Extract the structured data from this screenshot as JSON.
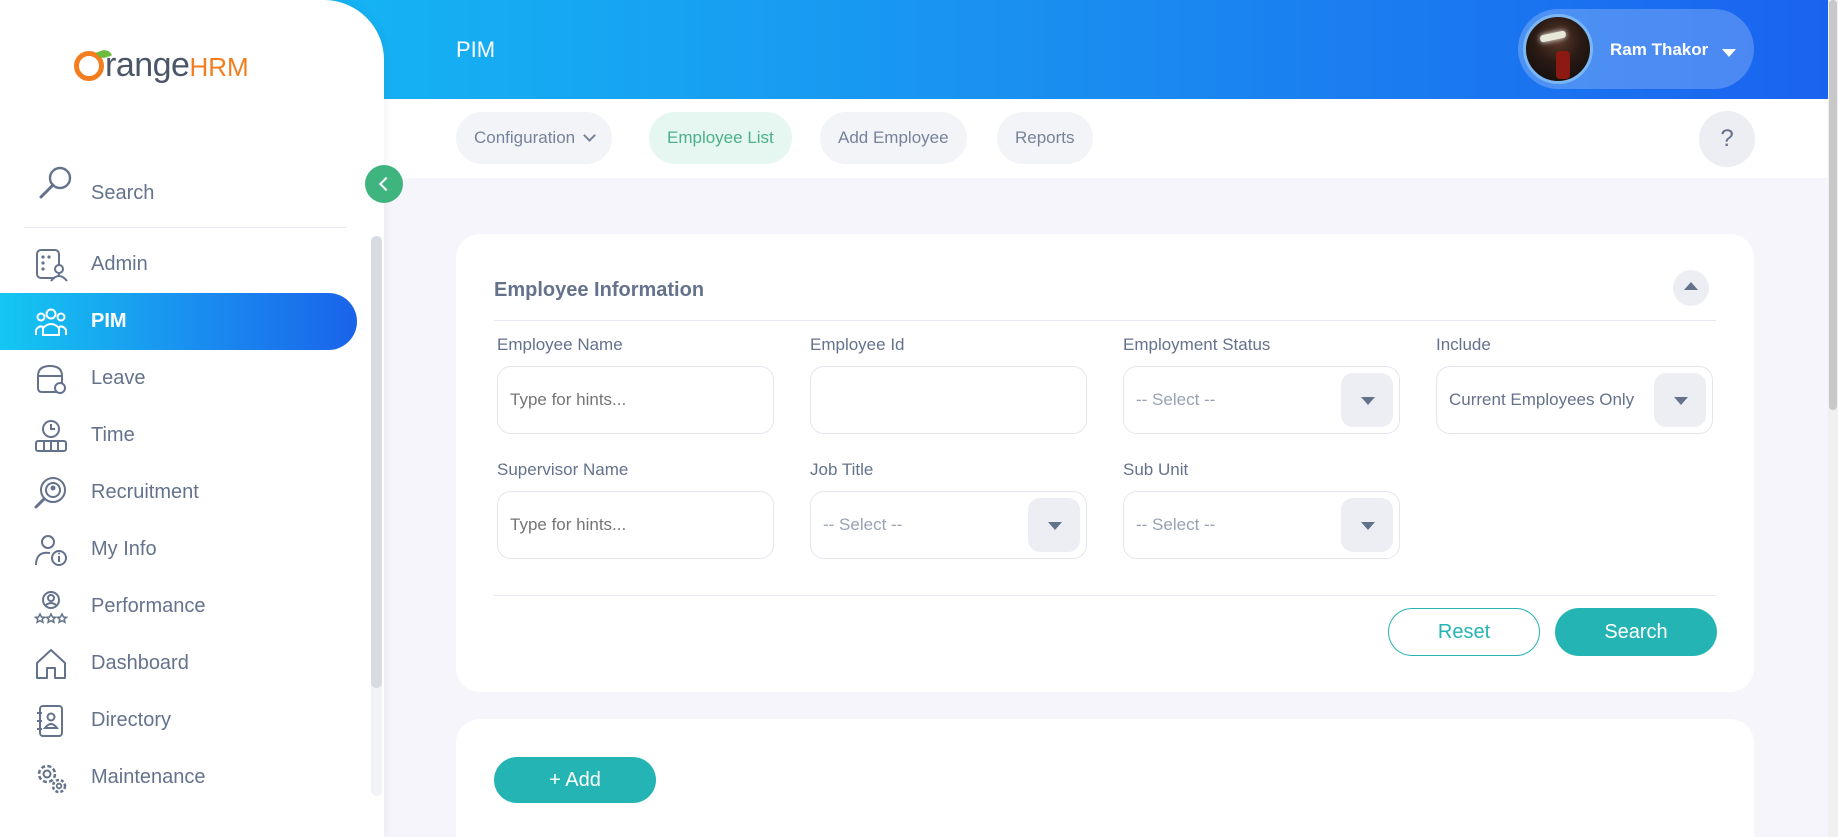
{
  "header": {
    "page_title": "PIM",
    "user_name": "Ram Thakor"
  },
  "logo": {
    "brand_main": "range",
    "brand_suffix": "HRM"
  },
  "subnav": {
    "tabs": [
      {
        "label": "Configuration"
      },
      {
        "label": "Employee List"
      },
      {
        "label": "Add Employee"
      },
      {
        "label": "Reports"
      }
    ],
    "help_label": "?"
  },
  "sidebar": {
    "search_label": "Search",
    "items": [
      {
        "label": "Admin",
        "icon": "admin-icon"
      },
      {
        "label": "PIM",
        "icon": "pim-icon"
      },
      {
        "label": "Leave",
        "icon": "leave-icon"
      },
      {
        "label": "Time",
        "icon": "time-icon"
      },
      {
        "label": "Recruitment",
        "icon": "recruitment-icon"
      },
      {
        "label": "My Info",
        "icon": "my-info-icon"
      },
      {
        "label": "Performance",
        "icon": "performance-icon"
      },
      {
        "label": "Dashboard",
        "icon": "dashboard-icon"
      },
      {
        "label": "Directory",
        "icon": "directory-icon"
      },
      {
        "label": "Maintenance",
        "icon": "maintenance-icon"
      }
    ]
  },
  "filter": {
    "title": "Employee Information",
    "fields": {
      "employee_name": {
        "label": "Employee Name",
        "placeholder": "Type for hints..."
      },
      "employee_id": {
        "label": "Employee Id",
        "value": ""
      },
      "employment_status": {
        "label": "Employment Status",
        "value": "-- Select --"
      },
      "include": {
        "label": "Include",
        "value": "Current Employees Only"
      },
      "supervisor_name": {
        "label": "Supervisor Name",
        "placeholder": "Type for hints..."
      },
      "job_title": {
        "label": "Job Title",
        "value": "-- Select --"
      },
      "sub_unit": {
        "label": "Sub Unit",
        "value": "-- Select --"
      }
    },
    "reset_label": "Reset",
    "search_label": "Search"
  },
  "list": {
    "add_label": "+  Add"
  },
  "colors": {
    "accent": "#25b4b4",
    "active_tab_bg": "#e6f6f0",
    "brand_orange": "#f27e20",
    "header_start": "#12c5f5",
    "header_end": "#1a63f0"
  }
}
